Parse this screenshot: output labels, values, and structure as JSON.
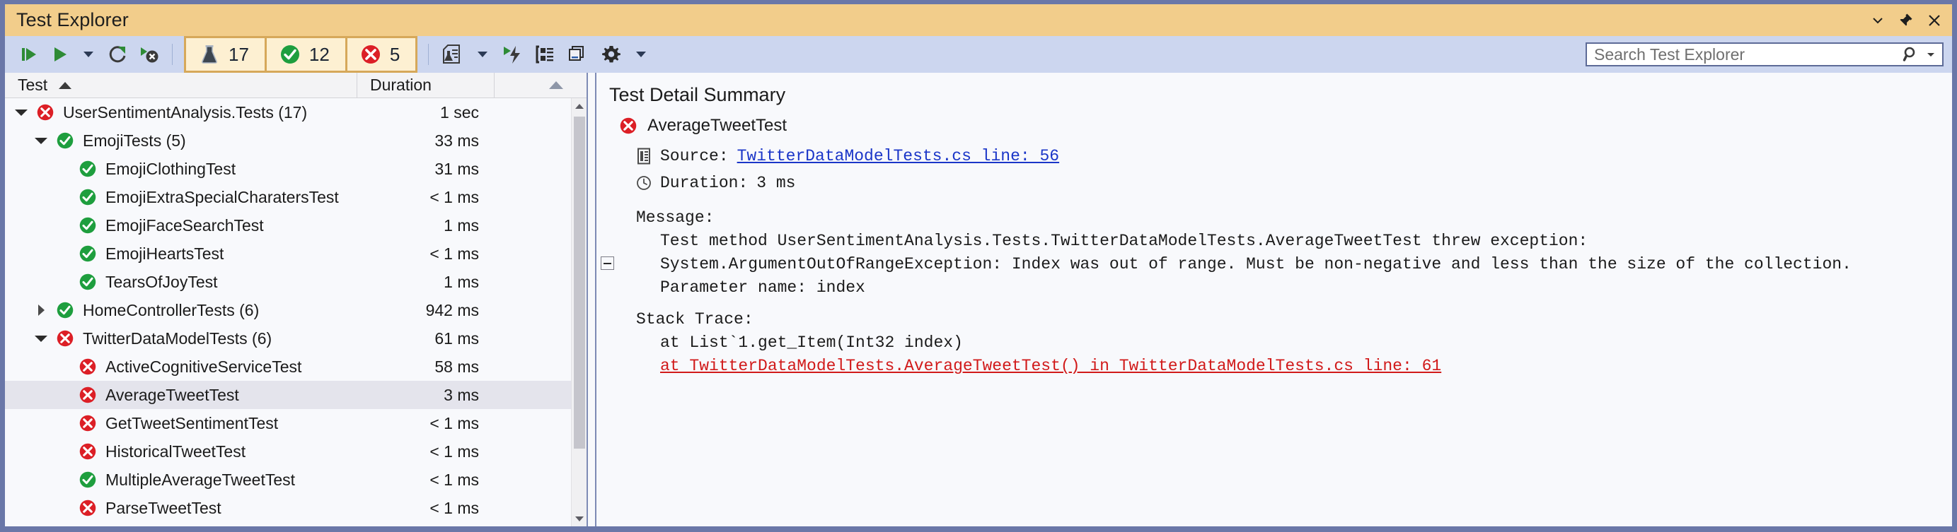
{
  "window": {
    "title": "Test Explorer",
    "buttons": [
      {
        "name": "dropdown-icon",
        "glyph": "▾"
      },
      {
        "name": "pin-icon",
        "glyph": "📌"
      },
      {
        "name": "close-icon",
        "glyph": "✕"
      }
    ]
  },
  "toolbar": {
    "icons": [
      {
        "name": "run-all-tests-icon",
        "label": "Run All"
      },
      {
        "name": "run-tests-icon",
        "label": "Run"
      },
      {
        "name": "run-dropdown-icon",
        "label": "Run Options"
      },
      {
        "name": "repeat-last-run-icon",
        "label": "Repeat Last Run"
      },
      {
        "name": "run-failed-tests-icon",
        "label": "Run Failed Tests"
      },
      {
        "name": "test-playlist-icon",
        "label": "Playlist"
      },
      {
        "name": "playlist-dropdown-icon",
        "label": "Playlist Options"
      },
      {
        "name": "run-tests-after-build-icon",
        "label": "Run Tests After Build"
      },
      {
        "name": "group-by-icon",
        "label": "Group By"
      },
      {
        "name": "show-test-output-icon",
        "label": "Show Test Output"
      },
      {
        "name": "settings-gear-icon",
        "label": "Settings"
      },
      {
        "name": "settings-dropdown-icon",
        "label": "Settings Options"
      }
    ],
    "counters": [
      {
        "name": "total-tests-counter",
        "icon": "beaker-icon",
        "value": "17"
      },
      {
        "name": "passed-tests-counter",
        "icon": "passed-icon",
        "value": "12"
      },
      {
        "name": "failed-tests-counter",
        "icon": "failed-icon",
        "value": "5"
      }
    ]
  },
  "search": {
    "placeholder": "Search Test Explorer",
    "value": "",
    "icon": "search-icon",
    "dropdown_icon": "chevron-down-icon"
  },
  "colors": {
    "title_bar": "#f2cd8b",
    "toolbar": "#ccd6ef",
    "frame_border": "#6a77a8",
    "pass_green": "#1e9e3e",
    "fail_red": "#dc1f26",
    "link_blue": "#1b36c8",
    "link_red": "#d11a1a",
    "selection": "#e4e4ec"
  },
  "tree": {
    "columns": [
      {
        "name": "column-test",
        "label": "Test",
        "sort": "ascending"
      },
      {
        "name": "column-duration",
        "label": "Duration"
      }
    ],
    "rows": [
      {
        "label": "UserSentimentAnalysis.Tests (17)",
        "duration": "1 sec",
        "status": "failed",
        "indent": 0,
        "twisty": "open",
        "selected": false
      },
      {
        "label": "EmojiTests (5)",
        "duration": "33 ms",
        "status": "passed",
        "indent": 1,
        "twisty": "open",
        "selected": false
      },
      {
        "label": "EmojiClothingTest",
        "duration": "31 ms",
        "status": "passed",
        "indent": 2,
        "twisty": "none",
        "selected": false
      },
      {
        "label": "EmojiExtraSpecialCharatersTest",
        "duration": "< 1 ms",
        "status": "passed",
        "indent": 2,
        "twisty": "none",
        "selected": false
      },
      {
        "label": "EmojiFaceSearchTest",
        "duration": "1 ms",
        "status": "passed",
        "indent": 2,
        "twisty": "none",
        "selected": false
      },
      {
        "label": "EmojiHeartsTest",
        "duration": "< 1 ms",
        "status": "passed",
        "indent": 2,
        "twisty": "none",
        "selected": false
      },
      {
        "label": "TearsOfJoyTest",
        "duration": "1 ms",
        "status": "passed",
        "indent": 2,
        "twisty": "none",
        "selected": false
      },
      {
        "label": "HomeControllerTests (6)",
        "duration": "942 ms",
        "status": "passed",
        "indent": 1,
        "twisty": "closed",
        "selected": false
      },
      {
        "label": "TwitterDataModelTests (6)",
        "duration": "61 ms",
        "status": "failed",
        "indent": 1,
        "twisty": "open",
        "selected": false
      },
      {
        "label": "ActiveCognitiveServiceTest",
        "duration": "58 ms",
        "status": "failed",
        "indent": 2,
        "twisty": "none",
        "selected": false
      },
      {
        "label": "AverageTweetTest",
        "duration": "3 ms",
        "status": "failed",
        "indent": 2,
        "twisty": "none",
        "selected": true
      },
      {
        "label": "GetTweetSentimentTest",
        "duration": "< 1 ms",
        "status": "failed",
        "indent": 2,
        "twisty": "none",
        "selected": false
      },
      {
        "label": "HistoricalTweetTest",
        "duration": "< 1 ms",
        "status": "failed",
        "indent": 2,
        "twisty": "none",
        "selected": false
      },
      {
        "label": "MultipleAverageTweetTest",
        "duration": "< 1 ms",
        "status": "passed",
        "indent": 2,
        "twisty": "none",
        "selected": false
      },
      {
        "label": "ParseTweetTest",
        "duration": "< 1 ms",
        "status": "failed",
        "indent": 2,
        "twisty": "none",
        "selected": false
      }
    ]
  },
  "detail": {
    "title": "Test Detail Summary",
    "test_name": "AverageTweetTest",
    "test_status": "failed",
    "source_label": "Source:",
    "source_link": "TwitterDataModelTests.cs line: 56",
    "duration_label": "Duration:",
    "duration_value": "3 ms",
    "message_label": "Message:",
    "message_lines": "Test method UserSentimentAnalysis.Tests.TwitterDataModelTests.AverageTweetTest threw exception:\nSystem.ArgumentOutOfRangeException: Index was out of range. Must be non-negative and less than the size of the collection.\nParameter name: index",
    "stack_label": "Stack Trace:",
    "stack_line_1": "at List`1.get_Item(Int32 index)",
    "stack_link": "at TwitterDataModelTests.AverageTweetTest() in TwitterDataModelTests.cs line: 61"
  }
}
